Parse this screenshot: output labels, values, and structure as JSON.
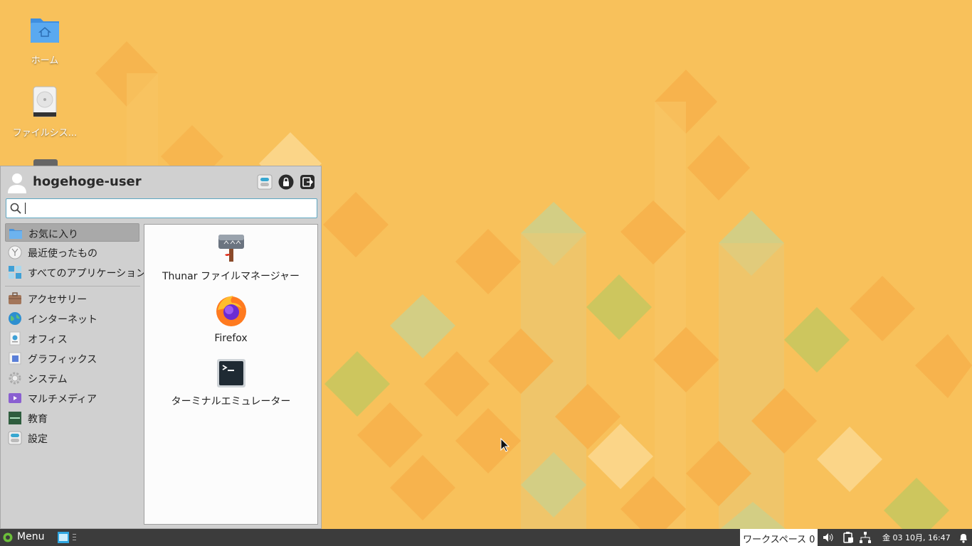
{
  "desktop": {
    "icons": [
      {
        "label": "ホーム",
        "icon": "home-folder-icon"
      },
      {
        "label": "ファイルシス...",
        "icon": "drive-harddisk-icon"
      }
    ]
  },
  "menu": {
    "username": "hogehoge-user",
    "header_buttons": [
      "settings-icon",
      "lock-icon",
      "logout-icon"
    ],
    "search_placeholder": "",
    "search_value": "",
    "categories": [
      {
        "label": "お気に入り",
        "icon": "favorites-folder-icon",
        "selected": true
      },
      {
        "label": "最近使ったもの",
        "icon": "recent-clock-icon"
      },
      {
        "label": "すべてのアプリケーション",
        "icon": "all-apps-icon"
      },
      {
        "label": "アクセサリー",
        "icon": "briefcase-icon"
      },
      {
        "label": "インターネット",
        "icon": "globe-icon"
      },
      {
        "label": "オフィス",
        "icon": "office-icon"
      },
      {
        "label": "グラフィックス",
        "icon": "graphics-icon"
      },
      {
        "label": "システム",
        "icon": "system-gear-icon"
      },
      {
        "label": "マルチメディア",
        "icon": "multimedia-icon"
      },
      {
        "label": "教育",
        "icon": "education-abc-icon"
      },
      {
        "label": "設定",
        "icon": "settings-toggle-icon"
      }
    ],
    "apps": [
      {
        "label": "Thunar ファイルマネージャー",
        "icon": "thunar-icon"
      },
      {
        "label": "Firefox",
        "icon": "firefox-icon"
      },
      {
        "label": "ターミナルエミュレーター",
        "icon": "terminal-icon"
      }
    ]
  },
  "taskbar": {
    "menu_label": "Menu",
    "workspace_label": "ワークスペース 0",
    "clock": "金 03 10月, 16:47",
    "colors": {
      "bar": "#3c3c3c",
      "accent": "#55a5c6",
      "wallpaper": "#f8c15b"
    }
  }
}
